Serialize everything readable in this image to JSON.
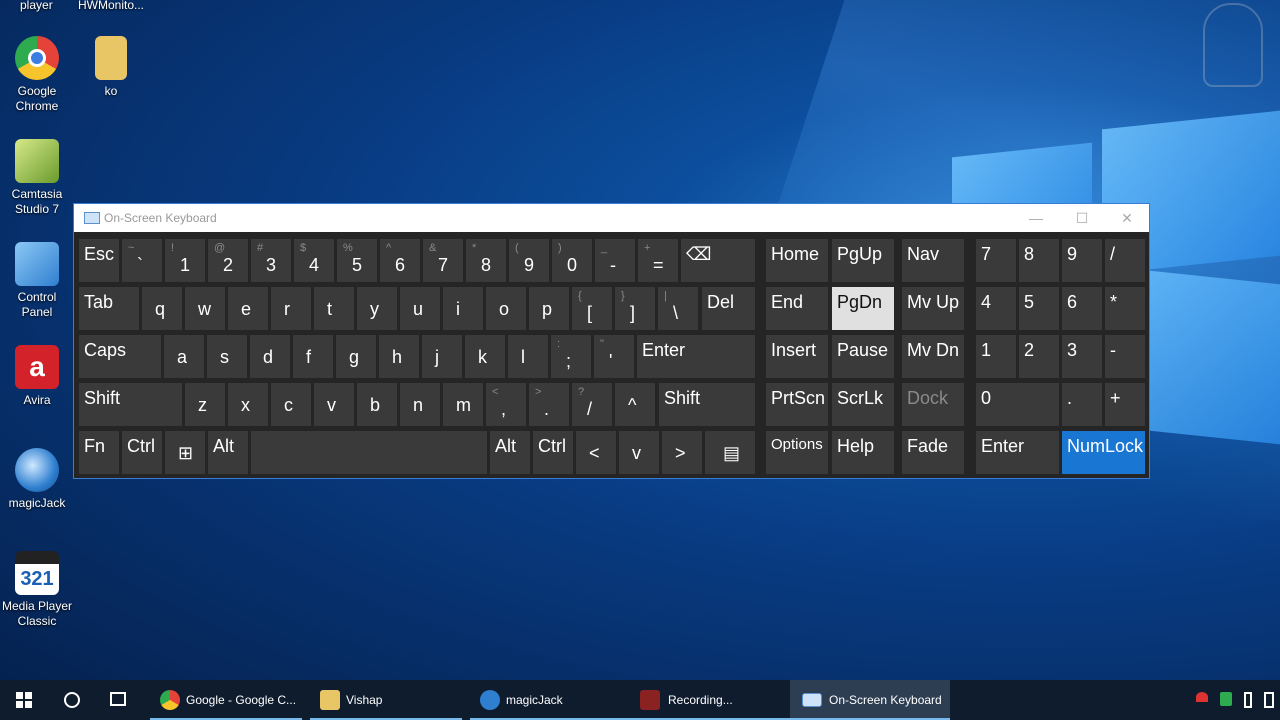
{
  "desktop": {
    "partial_labels": [
      "player",
      "HWMonito..."
    ],
    "icons": [
      {
        "label": "Google Chrome",
        "color": "#e5433a"
      },
      {
        "label": "ko",
        "color": "#e8c665"
      },
      {
        "label": "Camtasia Studio 7",
        "color": "#8ab84c"
      },
      {
        "label": "Control Panel",
        "color": "#3c8de0"
      },
      {
        "label": "Avira",
        "color": "#d3222a"
      },
      {
        "label": "magicJack",
        "color": "#2f7fd0"
      },
      {
        "label": "Media Player Classic",
        "color": "#333333"
      }
    ]
  },
  "osk": {
    "title": "On-Screen Keyboard",
    "controls": {
      "minimize": "—",
      "maximize": "☐",
      "close": "✕"
    },
    "row1": [
      {
        "main": "Esc"
      },
      {
        "shift": "~",
        "main": "`"
      },
      {
        "shift": "!",
        "main": "1"
      },
      {
        "shift": "@",
        "main": "2"
      },
      {
        "shift": "#",
        "main": "3"
      },
      {
        "shift": "$",
        "main": "4"
      },
      {
        "shift": "%",
        "main": "5"
      },
      {
        "shift": "^",
        "main": "6"
      },
      {
        "shift": "&",
        "main": "7"
      },
      {
        "shift": "*",
        "main": "8"
      },
      {
        "shift": "(",
        "main": "9"
      },
      {
        "shift": ")",
        "main": "0"
      },
      {
        "shift": "_",
        "main": "-"
      },
      {
        "shift": "+",
        "main": "="
      },
      {
        "main": "⌫"
      }
    ],
    "row2": [
      {
        "main": "Tab"
      },
      {
        "main": "q"
      },
      {
        "main": "w"
      },
      {
        "main": "e"
      },
      {
        "main": "r"
      },
      {
        "main": "t"
      },
      {
        "main": "y"
      },
      {
        "main": "u"
      },
      {
        "main": "i"
      },
      {
        "main": "o"
      },
      {
        "main": "p"
      },
      {
        "shift": "{",
        "main": "["
      },
      {
        "shift": "}",
        "main": "]"
      },
      {
        "shift": "|",
        "main": "\\"
      },
      {
        "main": "Del"
      }
    ],
    "row3": [
      {
        "main": "Caps"
      },
      {
        "main": "a"
      },
      {
        "main": "s"
      },
      {
        "main": "d"
      },
      {
        "main": "f"
      },
      {
        "main": "g"
      },
      {
        "main": "h"
      },
      {
        "main": "j"
      },
      {
        "main": "k"
      },
      {
        "main": "l"
      },
      {
        "shift": ":",
        "main": ";"
      },
      {
        "shift": "\"",
        "main": "'"
      },
      {
        "main": "Enter"
      }
    ],
    "row4": [
      {
        "main": "Shift"
      },
      {
        "main": "z"
      },
      {
        "main": "x"
      },
      {
        "main": "c"
      },
      {
        "main": "v"
      },
      {
        "main": "b"
      },
      {
        "main": "n"
      },
      {
        "main": "m"
      },
      {
        "shift": "<",
        "main": ","
      },
      {
        "shift": ">",
        "main": "."
      },
      {
        "shift": "?",
        "main": "/"
      },
      {
        "main": "^"
      },
      {
        "main": "Shift"
      }
    ],
    "row5": [
      {
        "main": "Fn"
      },
      {
        "main": "Ctrl"
      },
      {
        "main": "⊞"
      },
      {
        "main": "Alt"
      },
      {
        "main": ""
      },
      {
        "main": "Alt"
      },
      {
        "main": "Ctrl"
      },
      {
        "main": "<"
      },
      {
        "main": "v"
      },
      {
        "main": ">"
      },
      {
        "main": "▤"
      }
    ],
    "nav": [
      "Home",
      "PgUp",
      "Nav",
      "End",
      "PgDn",
      "Mv Up",
      "Insert",
      "Pause",
      "Mv Dn",
      "PrtScn",
      "ScrLk",
      "Dock",
      "Options",
      "Help",
      "Fade"
    ],
    "numpad": [
      "7",
      "8",
      "9",
      "/",
      "4",
      "5",
      "6",
      "*",
      "1",
      "2",
      "3",
      "-",
      "0",
      ".",
      "+",
      "Enter",
      "NumLock"
    ],
    "accent": "#1976d2"
  },
  "taskbar": {
    "items": [
      "Google - Google C...",
      "Vishap",
      "magicJack",
      "Recording...",
      "On-Screen Keyboard"
    ]
  }
}
